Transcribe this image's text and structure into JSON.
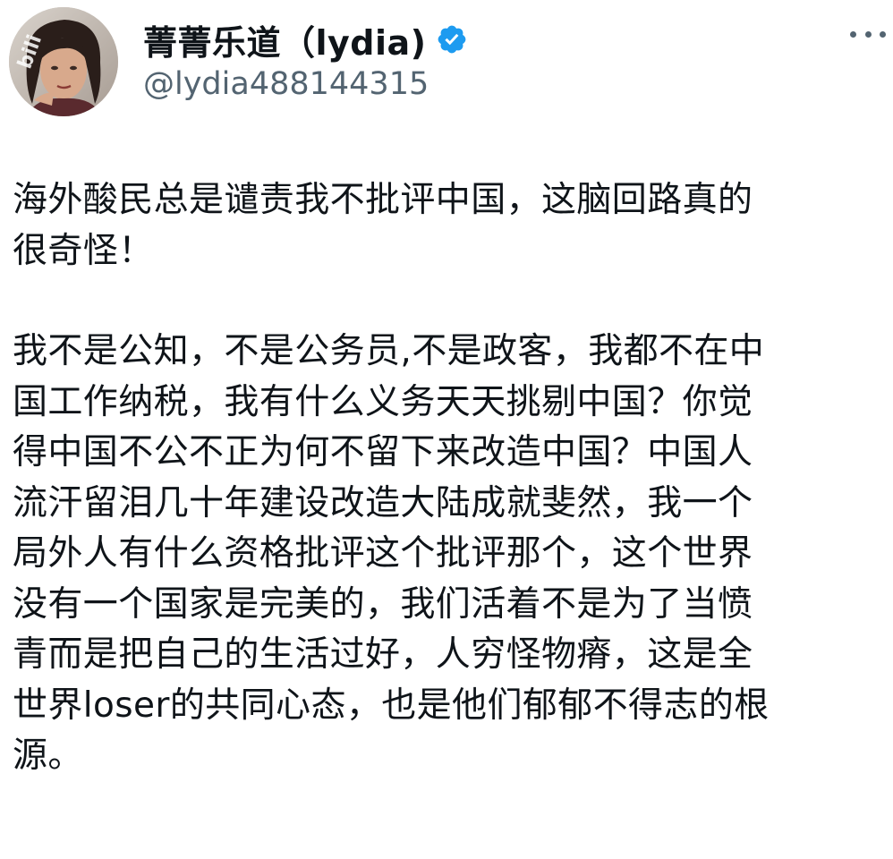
{
  "author": {
    "display_name": "菁菁乐道（lydia)",
    "handle": "@lydia488144315",
    "verified": true,
    "avatar_icon": "profile-photo"
  },
  "watermark": {
    "text": "bili"
  },
  "tweet": {
    "paragraphs": [
      "海外酸民总是谴责我不批评中国，这脑回路真的\n很奇怪！",
      "我不是公知，不是公务员,不是政客，我都不在中\n国工作纳税，我有什么义务天天挑剔中国？你觉\n得中国不公不正为何不留下来改造中国？中国人\n流汗留泪几十年建设改造大陆成就斐然，我一个\n局外人有什么资格批评这个批评那个，这个世界\n没有一个国家是完美的，我们活着不是为了当愤\n青而是把自己的生活过好，人穷怪物瘠，这是全\n世界loser的共同心态，也是他们郁郁不得志的根\n源。"
    ]
  },
  "colors": {
    "text_primary": "#0f1419",
    "text_secondary": "#536471",
    "verified_blue": "#1d9bf0",
    "background": "#ffffff"
  },
  "icons": {
    "verified": "verified-badge-icon",
    "more": "more-horizontal-icon"
  }
}
